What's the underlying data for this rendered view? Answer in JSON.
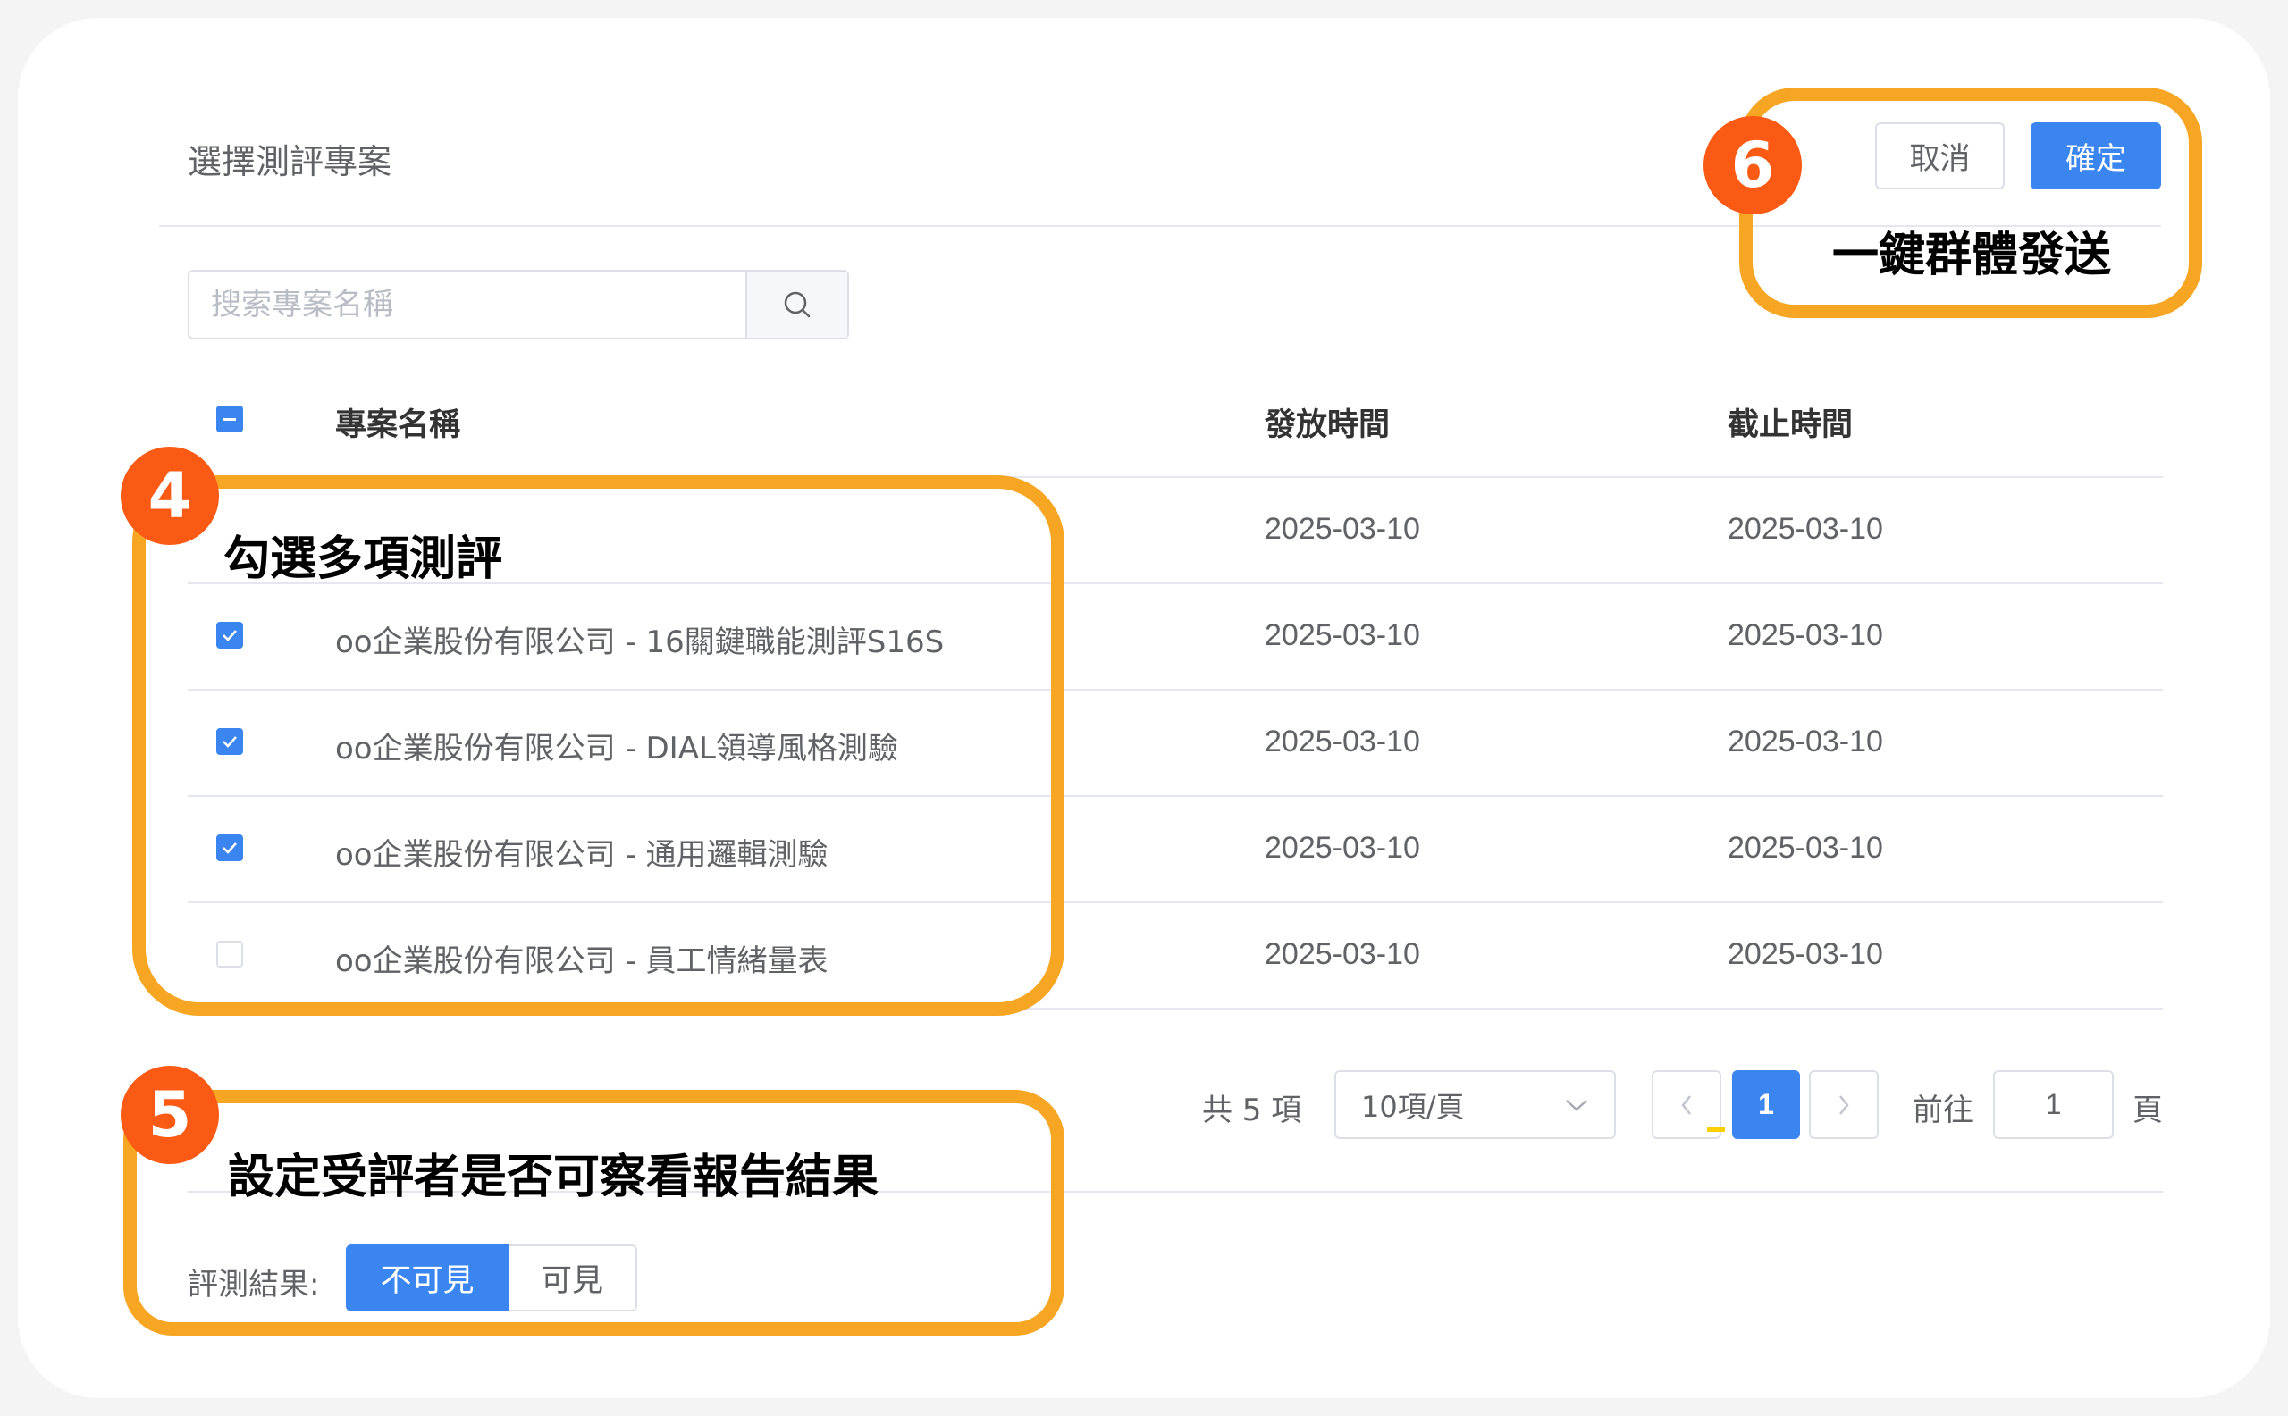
{
  "dialog": {
    "title": "選擇測評專案",
    "cancel_label": "取消",
    "confirm_label": "確定"
  },
  "search": {
    "placeholder": "搜索專案名稱"
  },
  "table": {
    "headers": {
      "name": "專案名稱",
      "release": "發放時間",
      "deadline": "截止時間"
    },
    "rows": [
      {
        "checked": false,
        "name": "",
        "release": "2025-03-10",
        "deadline": "2025-03-10"
      },
      {
        "checked": true,
        "name": "oo企業股份有限公司 - 16關鍵職能測評S16S",
        "release": "2025-03-10",
        "deadline": "2025-03-10"
      },
      {
        "checked": true,
        "name": "oo企業股份有限公司 - DIAL領導風格測驗",
        "release": "2025-03-10",
        "deadline": "2025-03-10"
      },
      {
        "checked": true,
        "name": "oo企業股份有限公司 - 通用邏輯測驗",
        "release": "2025-03-10",
        "deadline": "2025-03-10"
      },
      {
        "checked": false,
        "name": "oo企業股份有限公司 - 員工情緒量表",
        "release": "2025-03-10",
        "deadline": "2025-03-10"
      }
    ]
  },
  "pagination": {
    "total_label": "共 5 項",
    "page_size": "10項/頁",
    "current_page": "1",
    "goto_label": "前往",
    "goto_value": "1",
    "page_unit": "頁"
  },
  "result_visibility": {
    "label": "評測結果:",
    "options": [
      "不可見",
      "可見"
    ],
    "selected": "不可見"
  },
  "annotations": {
    "step4": {
      "number": "4",
      "text": "勾選多項測評"
    },
    "step5": {
      "number": "5",
      "text": "設定受評者是否可察看報告結果"
    },
    "step6": {
      "number": "6",
      "text": "一鍵群體發送"
    }
  },
  "colors": {
    "primary": "#3a85f0",
    "highlight": "#f6a623",
    "badge": "#fa5a14"
  }
}
